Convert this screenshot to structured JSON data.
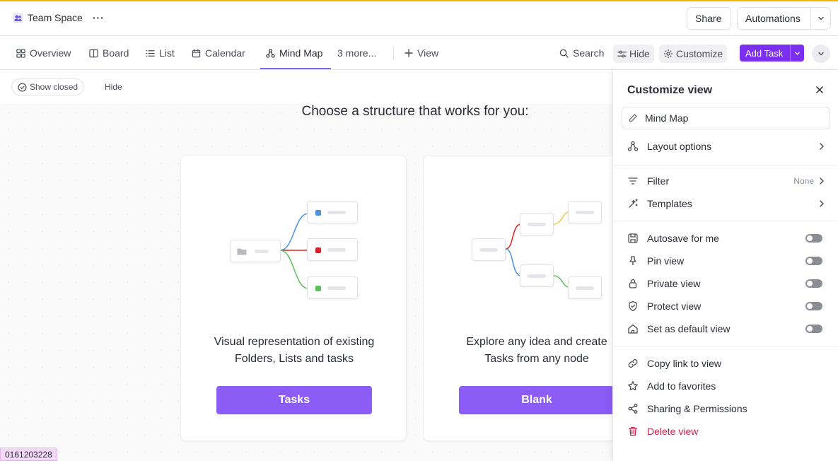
{
  "header": {
    "workspace_name": "Team Space",
    "more_label": "···",
    "share_label": "Share",
    "automations_label": "Automations"
  },
  "tabs": {
    "overview": "Overview",
    "board": "Board",
    "list": "List",
    "calendar": "Calendar",
    "mind_map": "Mind Map",
    "more": "3 more...",
    "add_view": "View"
  },
  "toolbar": {
    "search_label": "Search",
    "hide_label": "Hide",
    "customize_label": "Customize",
    "add_task_label": "Add Task"
  },
  "filterbar": {
    "show_closed_label": "Show closed",
    "hide_label": "Hide"
  },
  "main": {
    "headline": "Choose a structure that works for you:",
    "cards": [
      {
        "desc_line1": "Visual representation of existing",
        "desc_line2": "Folders, Lists and tasks",
        "button_label": "Tasks"
      },
      {
        "desc_line1": "Explore any idea and create",
        "desc_line2": "Tasks from any node",
        "button_label": "Blank"
      }
    ]
  },
  "panel": {
    "title": "Customize view",
    "view_name": "Mind Map",
    "layout_options": "Layout options",
    "filter": "Filter",
    "filter_value": "None",
    "templates": "Templates",
    "autosave": "Autosave for me",
    "pin_view": "Pin view",
    "private_view": "Private view",
    "protect_view": "Protect view",
    "default_view": "Set as default view",
    "copy_link": "Copy link to view",
    "add_favorites": "Add to favorites",
    "sharing": "Sharing & Permissions",
    "delete_view": "Delete view"
  },
  "toggles": {
    "autosave": false,
    "pin_view": false,
    "private_view": false,
    "protect_view": false,
    "default_view": false
  },
  "footer": {
    "id_badge": "0161203228"
  },
  "colors": {
    "accent": "#7b68ee",
    "add_task_button": "#7b2ff0",
    "card_button": "#8b5cf6",
    "danger": "#d0214b",
    "top_stripe": "#f5b301",
    "branch_blue": "#4a90e2",
    "branch_red": "#e02020",
    "branch_green": "#5bc25b",
    "branch_yellow": "#f2c94c"
  }
}
